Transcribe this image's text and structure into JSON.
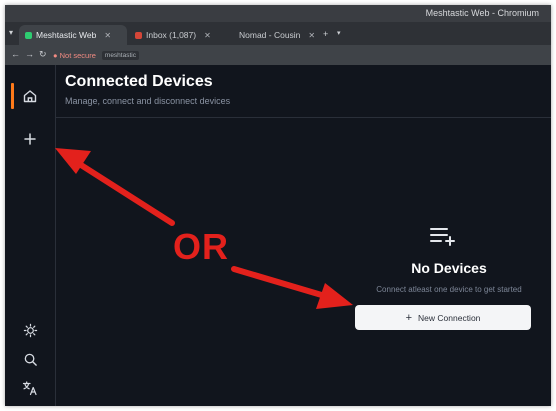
{
  "window": {
    "title": "Meshtastic Web - Chromium"
  },
  "browser": {
    "tabs": [
      {
        "label": "Meshtastic Web",
        "favicon_color": "#2ecc71"
      },
      {
        "label": "Inbox (1,087)",
        "favicon_color": "#d44638"
      },
      {
        "label": "Nomad - Cousin",
        "favicon_color": "#9aa0a6"
      }
    ],
    "security_label": "Not secure",
    "url": "meshtastic"
  },
  "sidebar": {
    "items": [
      {
        "name": "home",
        "icon": "home-icon"
      },
      {
        "name": "add",
        "icon": "plus-icon"
      },
      {
        "name": "theme",
        "icon": "sun-icon"
      },
      {
        "name": "search",
        "icon": "search-icon"
      },
      {
        "name": "language",
        "icon": "translate-icon"
      }
    ],
    "accent": "#ff7a1a"
  },
  "main": {
    "title": "Connected Devices",
    "subtitle": "Manage, connect and disconnect devices",
    "empty_state": {
      "icon": "list-add-icon",
      "title": "No Devices",
      "description": "Connect atleast one device to get started",
      "button_label": "New Connection"
    }
  },
  "annotation": {
    "text": "OR",
    "color": "#e3211c"
  }
}
